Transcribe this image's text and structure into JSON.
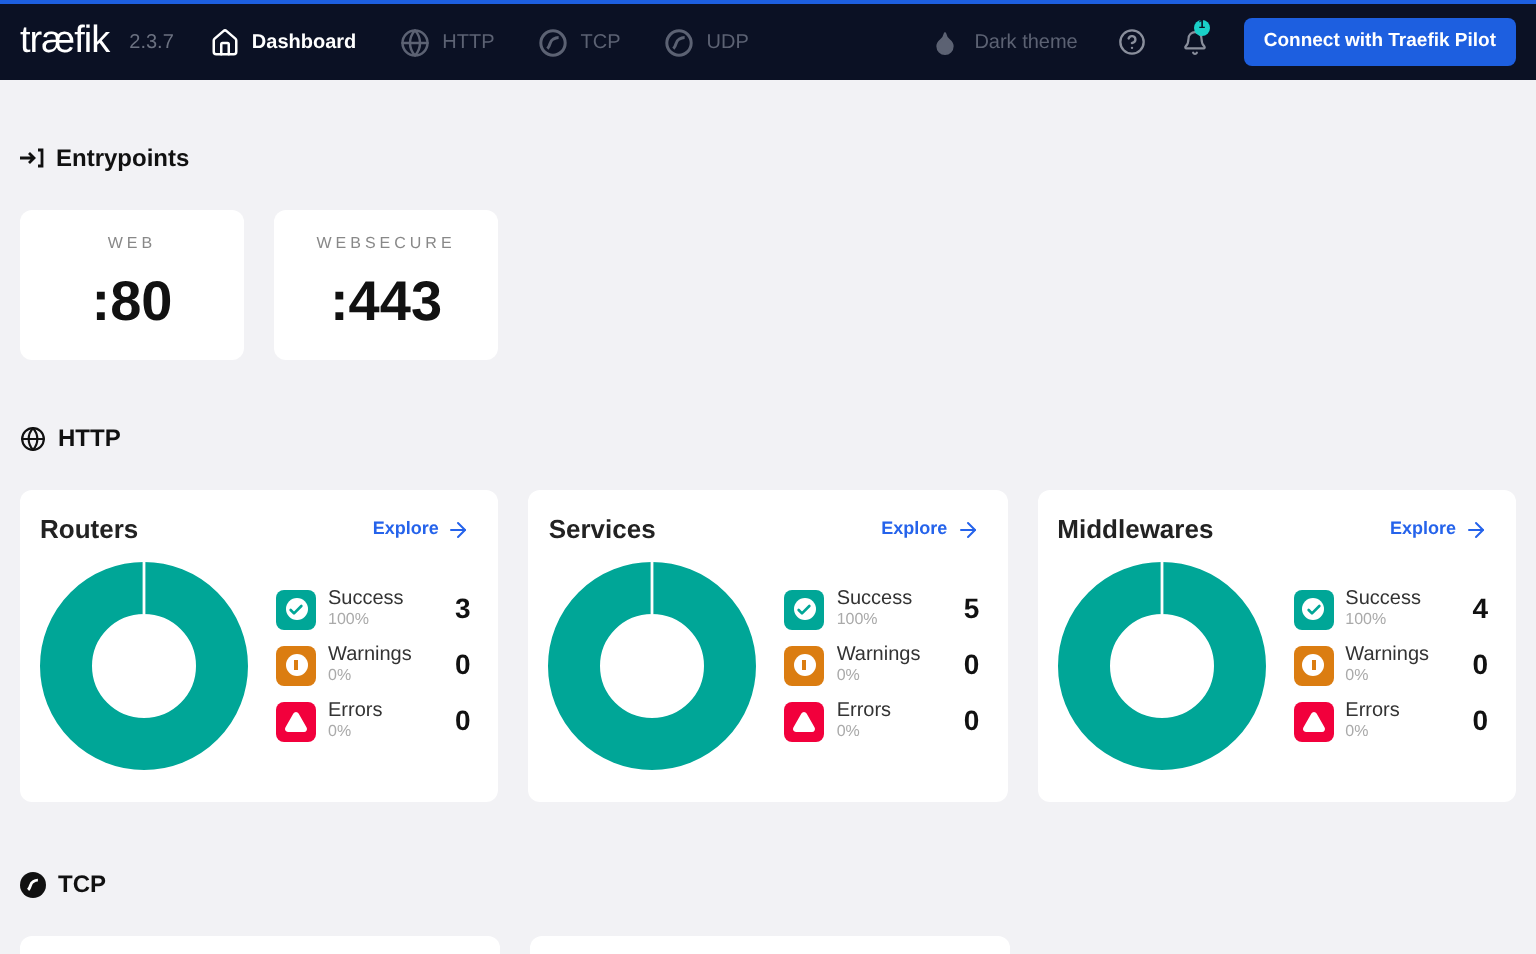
{
  "navbar": {
    "logo": "træfik",
    "version": "2.3.7",
    "items": [
      {
        "label": "Dashboard",
        "kind": "home",
        "selected": true
      },
      {
        "label": "HTTP",
        "kind": "globe",
        "selected": false
      },
      {
        "label": "TCP",
        "kind": "tcp",
        "selected": false
      },
      {
        "label": "UDP",
        "kind": "tcp",
        "selected": false
      }
    ],
    "theme_toggle": "Dark theme",
    "notification_count": "1",
    "pilot_button": "Connect with Traefik Pilot"
  },
  "entrypoints": {
    "title": "Entrypoints",
    "items": [
      {
        "name": "WEB",
        "port": ":80"
      },
      {
        "name": "WEBSECURE",
        "port": ":443"
      }
    ]
  },
  "http": {
    "title": "HTTP",
    "cards": [
      {
        "title": "Routers",
        "link": "Explore",
        "stats": [
          {
            "kind": "success",
            "label": "Success",
            "percent": "100%",
            "count": "3"
          },
          {
            "kind": "warning",
            "label": "Warnings",
            "percent": "0%",
            "count": "0"
          },
          {
            "kind": "error",
            "label": "Errors",
            "percent": "0%",
            "count": "0"
          }
        ]
      },
      {
        "title": "Services",
        "link": "Explore",
        "stats": [
          {
            "kind": "success",
            "label": "Success",
            "percent": "100%",
            "count": "5"
          },
          {
            "kind": "warning",
            "label": "Warnings",
            "percent": "0%",
            "count": "0"
          },
          {
            "kind": "error",
            "label": "Errors",
            "percent": "0%",
            "count": "0"
          }
        ]
      },
      {
        "title": "Middlewares",
        "link": "Explore",
        "stats": [
          {
            "kind": "success",
            "label": "Success",
            "percent": "100%",
            "count": "4"
          },
          {
            "kind": "warning",
            "label": "Warnings",
            "percent": "0%",
            "count": "0"
          },
          {
            "kind": "error",
            "label": "Errors",
            "percent": "0%",
            "count": "0"
          }
        ]
      }
    ]
  },
  "tcp": {
    "title": "TCP"
  }
}
